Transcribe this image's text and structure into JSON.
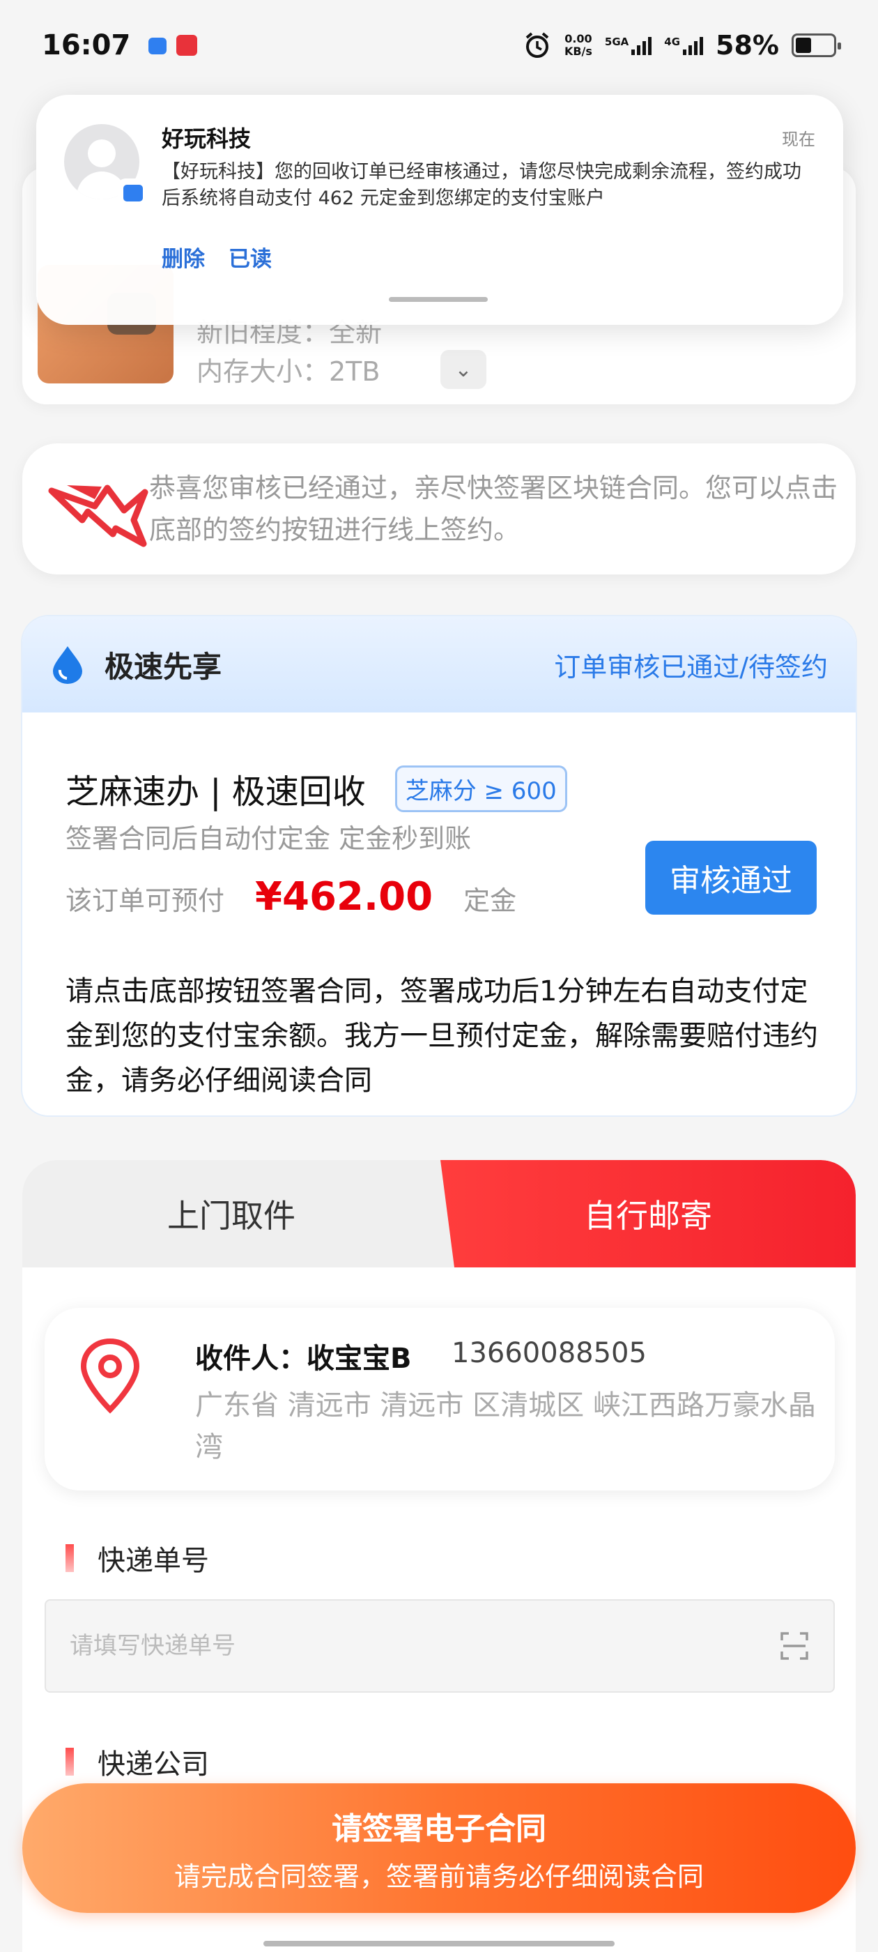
{
  "status_bar": {
    "time": "16:07",
    "net_speed": "0.00",
    "net_unit": "KB/s",
    "sim1": "5GA",
    "sim2": "4G",
    "battery": "58%"
  },
  "notification": {
    "app": "好玩科技",
    "time": "现在",
    "body": "【好玩科技】您的回收订单已经审核通过，请您尽快完成剩余流程，签约成功后系统将自动支付 462 元定金到您绑定的支付宝账户",
    "actions": [
      "删除",
      "已读"
    ]
  },
  "product": {
    "condition": "新旧程度：全新",
    "storage": "内存大小：2TB"
  },
  "tip": {
    "text": "恭喜您审核已经通过，亲尽快签署区块链合同。您可以点击底部的签约按钮进行线上签约。"
  },
  "express": {
    "title": "极速先享",
    "status": "订单审核已通过/待签约",
    "service": "芝麻速办 | 极速回收",
    "badge": "芝麻分 ≥ 600",
    "subtitle": "签署合同后自动付定金 定金秒到账",
    "prepay_label": "该订单可预付",
    "amount": "¥462.00",
    "unit": "定金",
    "approve_button": "审核通过",
    "description": "请点击底部按钮签署合同，签署成功后1分钟左右自动支付定金到您的支付宝余额。我方一旦预付定金，解除需要赔付违约金，请务必仔细阅读合同"
  },
  "shipping": {
    "tabs": [
      "上门取件",
      "自行邮寄"
    ],
    "receiver": "收件人：收宝宝B",
    "phone": "13660088505",
    "address": "广东省 清远市 清远市 区清城区 峡江西路万豪水晶湾",
    "tracking_label": "快递单号",
    "tracking_placeholder": "请填写快递单号",
    "company_label": "快递公司"
  },
  "sign": {
    "title": "请签署电子合同",
    "subtitle": "请完成合同签署，签署前请务必仔细阅读合同"
  },
  "colors": {
    "accent_blue": "#2a7ae8",
    "price_red": "#e8000b",
    "tab_red": "#f5222d",
    "button_orange": "#ff7530"
  }
}
